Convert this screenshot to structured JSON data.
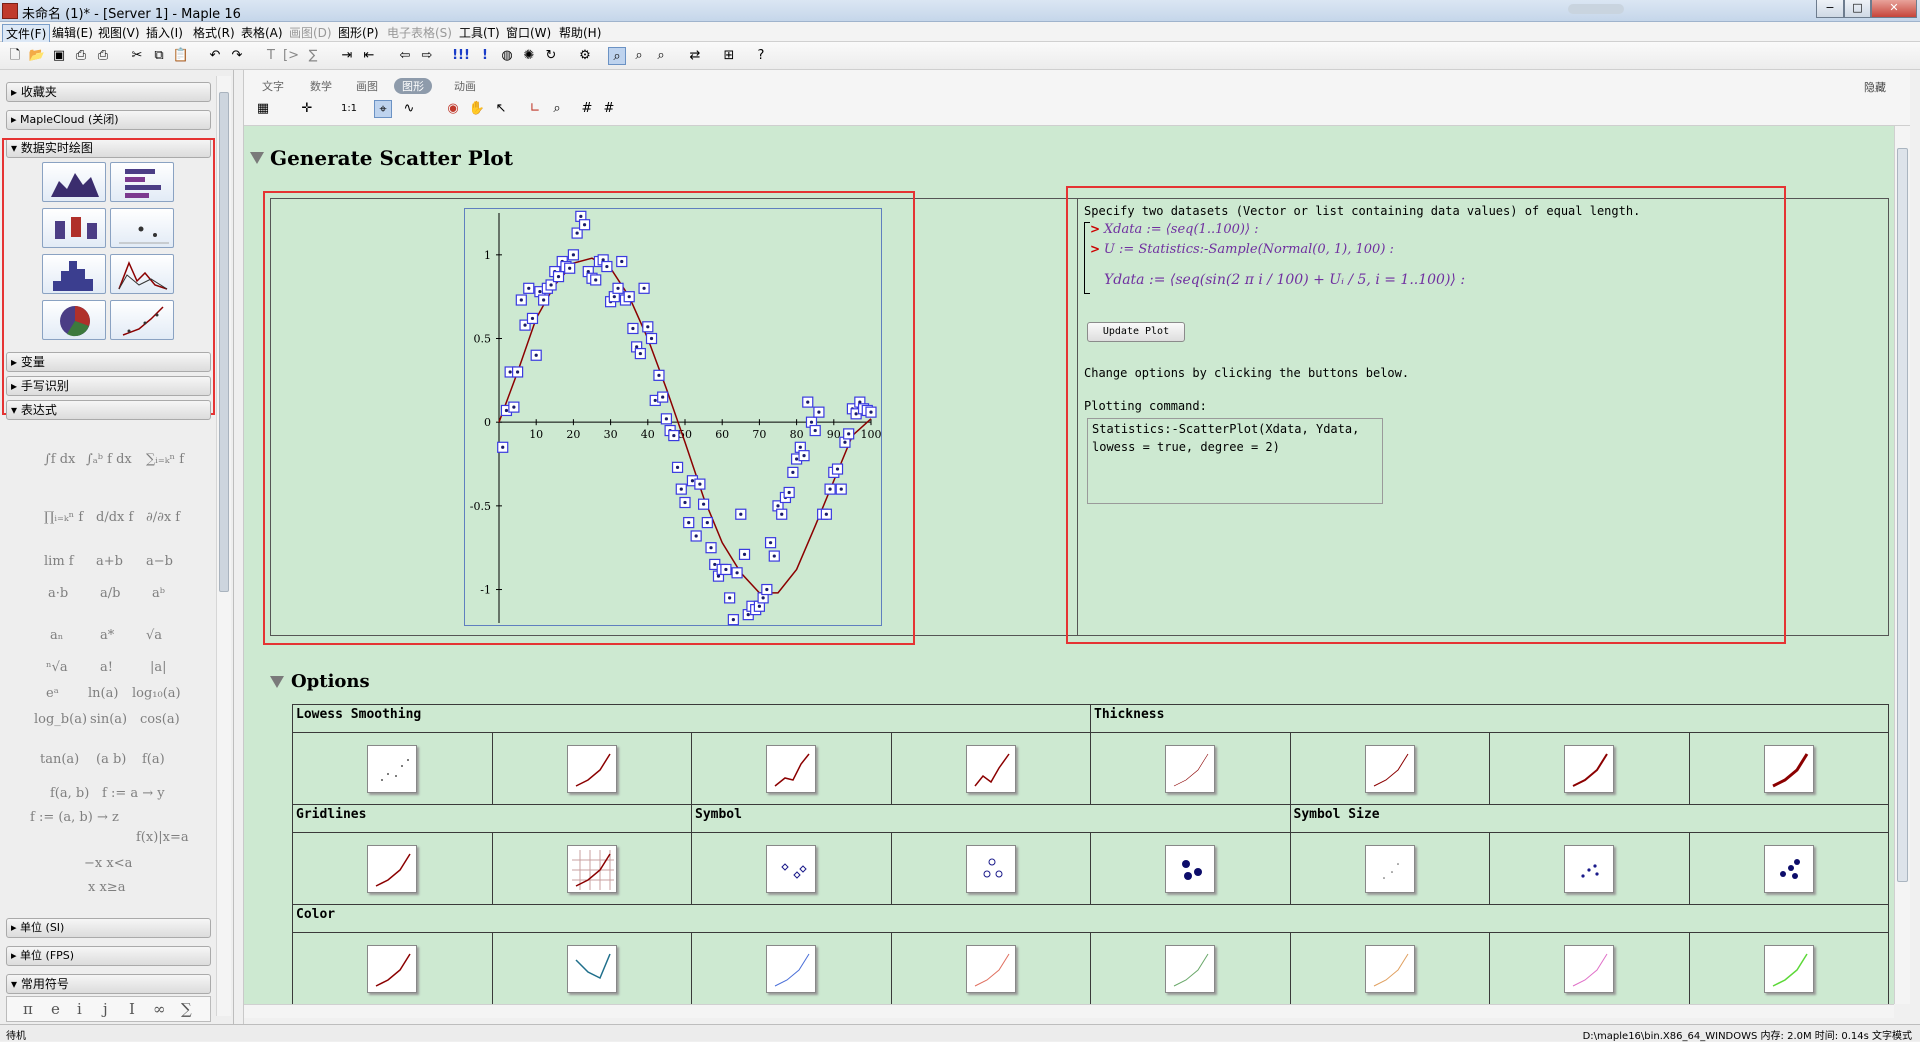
{
  "window": {
    "title": "未命名 (1)* - [Server 1] - Maple 16",
    "buttons": [
      "−",
      "□",
      "✕"
    ]
  },
  "menu": [
    {
      "label": "文件(F)"
    },
    {
      "label": "编辑(E)"
    },
    {
      "label": "视图(V)"
    },
    {
      "label": "插入(I)"
    },
    {
      "label": "格式(R)"
    },
    {
      "label": "表格(A)"
    },
    {
      "label": "画图(D)"
    },
    {
      "label": "图形(P)"
    },
    {
      "label": "电子表格(S)"
    },
    {
      "label": "工具(T)"
    },
    {
      "label": "窗口(W)"
    },
    {
      "label": "帮助(H)"
    }
  ],
  "palette": {
    "favorites": "收藏夹",
    "maplecloud": "MapleCloud (关闭)",
    "live_data_plots": "数据实时绘图",
    "variables": "变量",
    "handwriting": "手写识别",
    "expression": "表达式",
    "units_si": "单位 (SI)",
    "units_fps": "单位 (FPS)",
    "common_symbols": "常用符号",
    "expressions": [
      "∫f dx",
      "∫ₐᵇ f dx",
      "∑ᵢ₌ₖⁿ f",
      "∏ᵢ₌ₖⁿ f",
      "d/dx f",
      "∂/∂x f",
      "lim f",
      "a+b",
      "a−b",
      "a·b",
      "a/b",
      "aᵇ",
      "aₙ",
      "a*",
      "√a",
      "ⁿ√a",
      "a!",
      "|a|",
      "eᵃ",
      "ln(a)",
      "log₁₀(a)",
      "log_b(a)",
      "sin(a)",
      "cos(a)",
      "tan(a)",
      "(a b)",
      "f(a)",
      "f(a, b)",
      "f := a → y",
      "f := (a, b) → z",
      "f(x)|x=a",
      "−x  x<a",
      "x  x≥a"
    ],
    "symbols": [
      "π",
      "e",
      "i",
      "j",
      "I",
      "∞",
      "∑"
    ]
  },
  "context_tabs": [
    "文字",
    "数学",
    "画图",
    "图形",
    "动画"
  ],
  "context_hide": "隐藏",
  "doc": {
    "section_title": "Generate Scatter Plot",
    "desc": "Specify two datasets (Vector or list containing data values) of equal length.",
    "xdata_line": "Xdata := ⟨seq(1..100)⟩ :",
    "u_line": "U := Statistics:-Sample(Normal(0, 1), 100) :",
    "ydata_line": "Ydata := ⟨seq(sin(2 π i / 100) + Uᵢ / 5, i = 1..100)⟩ :",
    "update_button": "Update Plot",
    "change_text": "Change options by clicking the buttons below.",
    "plotting_label": "Plotting command:",
    "command_lines": [
      "Statistics:-ScatterPlot(Xdata, Ydata,",
      "lowess = true, degree = 2)"
    ],
    "options_title": "Options",
    "option_groups": {
      "lowess": "Lowess Smoothing",
      "thickness": "Thickness",
      "gridlines": "Gridlines",
      "symbol": "Symbol",
      "symbol_size": "Symbol Size",
      "color": "Color"
    }
  },
  "chart_data": {
    "type": "scatter",
    "xlim": [
      0,
      100
    ],
    "ylim": [
      -1.2,
      1.25
    ],
    "xticks": [
      "10",
      "20",
      "30",
      "40",
      "50",
      "60",
      "70",
      "80",
      "90",
      "100"
    ],
    "yticks": [
      "1",
      "0.5",
      "0",
      "-0.5",
      "-1"
    ],
    "xtick_values": [
      10,
      20,
      30,
      40,
      50,
      60,
      70,
      80,
      90,
      100
    ],
    "ytick_values": [
      1,
      0.5,
      0,
      -0.5,
      -1
    ],
    "x": [
      1,
      2,
      3,
      4,
      5,
      6,
      7,
      8,
      9,
      10,
      11,
      12,
      13,
      14,
      15,
      16,
      17,
      18,
      19,
      20,
      21,
      22,
      23,
      24,
      25,
      26,
      27,
      28,
      29,
      30,
      31,
      32,
      33,
      34,
      35,
      36,
      37,
      38,
      39,
      40,
      41,
      42,
      43,
      44,
      45,
      46,
      47,
      48,
      49,
      50,
      51,
      52,
      53,
      54,
      55,
      56,
      57,
      58,
      59,
      60,
      61,
      62,
      63,
      64,
      65,
      66,
      67,
      68,
      69,
      70,
      71,
      72,
      73,
      74,
      75,
      76,
      77,
      78,
      79,
      80,
      81,
      82,
      83,
      84,
      85,
      86,
      87,
      88,
      89,
      90,
      91,
      92,
      93,
      94,
      95,
      96,
      97,
      98,
      99,
      100
    ],
    "y": [
      -0.15,
      0.07,
      0.3,
      0.09,
      0.3,
      0.73,
      0.58,
      0.8,
      0.62,
      0.4,
      0.78,
      0.73,
      0.8,
      0.82,
      0.9,
      0.87,
      0.96,
      0.93,
      0.92,
      1.0,
      1.13,
      1.23,
      1.18,
      0.9,
      0.86,
      0.85,
      0.96,
      0.97,
      0.93,
      0.72,
      0.75,
      0.8,
      0.96,
      0.73,
      0.75,
      0.56,
      0.45,
      0.41,
      0.8,
      0.57,
      0.5,
      0.13,
      0.28,
      0.15,
      0.02,
      -0.05,
      -0.08,
      -0.27,
      -0.4,
      -0.48,
      -0.6,
      -0.35,
      -0.68,
      -0.37,
      -0.49,
      -0.6,
      -0.75,
      -0.85,
      -0.92,
      -0.88,
      -0.88,
      -1.05,
      -1.18,
      -0.9,
      -0.55,
      -0.79,
      -1.15,
      -1.1,
      -1.12,
      -1.1,
      -1.05,
      -1.0,
      -0.72,
      -0.8,
      -0.5,
      -0.55,
      -0.45,
      -0.42,
      -0.3,
      -0.22,
      -0.15,
      -0.2,
      0.12,
      0.0,
      -0.05,
      0.06,
      -0.55,
      -0.55,
      -0.4,
      -0.3,
      -0.28,
      -0.4,
      -0.12,
      -0.07,
      0.08,
      0.05,
      0.12,
      0.08,
      0.07,
      0.06
    ],
    "lowess_curve": {
      "x": [
        0,
        5,
        10,
        15,
        20,
        25,
        30,
        35,
        40,
        45,
        50,
        55,
        60,
        65,
        70,
        75,
        80,
        85,
        90,
        95,
        100
      ],
      "y": [
        0.0,
        0.3,
        0.62,
        0.82,
        0.95,
        0.98,
        0.92,
        0.75,
        0.5,
        0.2,
        -0.12,
        -0.45,
        -0.72,
        -0.9,
        -1.02,
        -1.02,
        -0.88,
        -0.62,
        -0.35,
        -0.08,
        0.02
      ]
    },
    "marker_color": "#3a3ae0",
    "curve_color": "#8b0000"
  },
  "status": {
    "left": "待机",
    "right": "D:\\maple16\\bin.X86_64_WINDOWS  内存: 2.0M  时间: 0.14s  文字模式"
  }
}
